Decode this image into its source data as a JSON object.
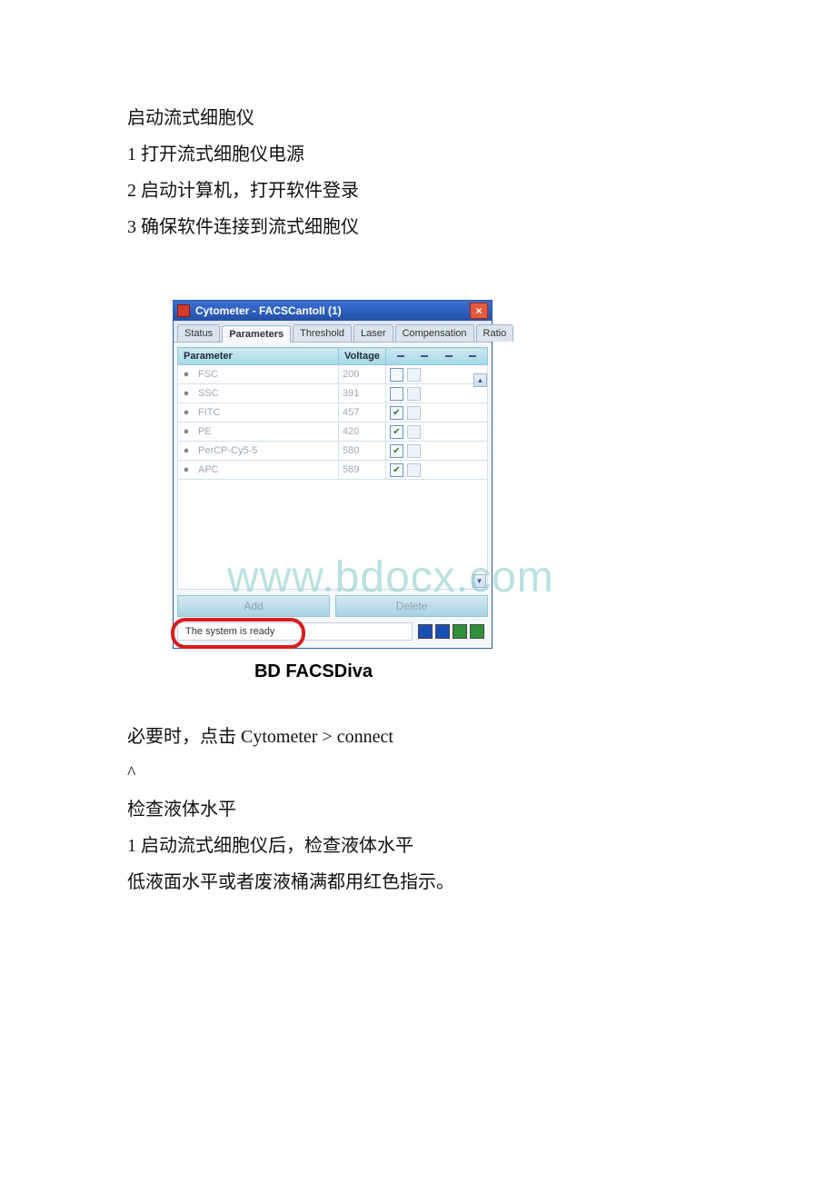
{
  "text": {
    "p1": "启动流式细胞仪",
    "p2": "1 打开流式细胞仪电源",
    "p3": "2 启动计算机，打开软件登录",
    "p4": "3 确保软件连接到流式细胞仪",
    "p5": "必要时，点击 Cytometer > connect",
    "p6": "^",
    "p7": "检查液体水平",
    "p8": "1 启动流式细胞仪后，检查液体水平",
    "p9": "低液面水平或者废液桶满都用红色指示。"
  },
  "window": {
    "title": "Cytometer - FACSCantoII (1)",
    "close_glyph": "×",
    "tabs": [
      "Status",
      "Parameters",
      "Threshold",
      "Laser",
      "Compensation",
      "Ratio"
    ],
    "active_tab_index": 1,
    "headers": {
      "param": "Parameter",
      "voltage": "Voltage"
    },
    "rows": [
      {
        "name": "FSC",
        "voltage": "200",
        "log": false
      },
      {
        "name": "SSC",
        "voltage": "391",
        "log": false
      },
      {
        "name": "FITC",
        "voltage": "457",
        "log": true
      },
      {
        "name": "PE",
        "voltage": "420",
        "log": true
      },
      {
        "name": "PerCP-Cy5-5",
        "voltage": "580",
        "log": true
      },
      {
        "name": "APC",
        "voltage": "589",
        "log": true
      }
    ],
    "buttons": {
      "add": "Add",
      "delete": "Delete"
    },
    "status_text": "The system is ready",
    "status_colors": [
      "#1a4fb5",
      "#1a4fb5",
      "#2f8f3a",
      "#2f8f3a"
    ]
  },
  "caption": "BD FACSDiva",
  "watermark": "www.bdocx.com"
}
